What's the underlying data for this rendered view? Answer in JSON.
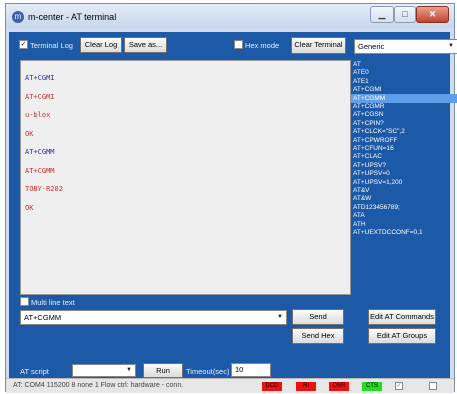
{
  "window": {
    "title": "m-center - AT terminal",
    "minimize_glyph": "▁",
    "maximize_glyph": "□",
    "close_glyph": "✕"
  },
  "toolbar": {
    "terminal_log_label": "Terminal Log",
    "terminal_log_checked": true,
    "clear_log_label": "Clear Log",
    "save_as_label": "Save as...",
    "hex_mode_label": "Hex mode",
    "hex_mode_checked": false,
    "clear_terminal_label": "Clear Terminal",
    "device_select_value": "Generic"
  },
  "terminal": {
    "lines": [
      {
        "text": "AT+CGMI",
        "color": "#2a2ab0"
      },
      {
        "text": "AT+CGMI",
        "color": "#c03030"
      },
      {
        "text": "u-blox",
        "color": "#c03030"
      },
      {
        "text": "OK",
        "color": "#c03030"
      },
      {
        "text": "AT+CGMM",
        "color": "#2a2ab0"
      },
      {
        "text": "AT+CGMM",
        "color": "#c03030"
      },
      {
        "text": "TOBY-R202",
        "color": "#c03030"
      },
      {
        "text": "OK",
        "color": "#c03030"
      }
    ]
  },
  "commands": {
    "selected": "AT+CGMM",
    "items": [
      "AT",
      "ATE0",
      "ATE1",
      "AT+CGMI",
      "AT+CGMM",
      "AT+CGMR",
      "AT+CGSN",
      "AT+CPIN?",
      "AT+CLCK=\"SC\",2",
      "AT+CPWROFF",
      "AT+CFUN=16",
      "AT+CLAC",
      "AT+UPSV?",
      "AT+UPSV=0",
      "AT+UPSV=1,200",
      "AT&V",
      "AT&W",
      "ATD123456789;",
      "ATA",
      "ATH",
      "AT+UEXTDCCONF=0,1"
    ]
  },
  "input": {
    "multi_line_label": "Multi line text",
    "command_value": "AT+CGMM",
    "send_label": "Send",
    "send_hex_label": "Send Hex",
    "edit_at_commands_label": "Edit AT Commands",
    "edit_at_groups_label": "Edit AT Groups"
  },
  "script": {
    "at_script_label": "AT script",
    "run_label": "Run",
    "timeout_label": "Timeout(sec)",
    "timeout_value": "10"
  },
  "status": {
    "text": "AT: COM4 115200 8 none 1 Flow ctrl: hardware - conn.",
    "leds": [
      {
        "label": "DCD",
        "color": "#ee1111"
      },
      {
        "label": "RI",
        "color": "#ee1111"
      },
      {
        "label": "DSR",
        "color": "#ee1111"
      },
      {
        "label": "CTS",
        "color": "#22dd22"
      }
    ]
  }
}
